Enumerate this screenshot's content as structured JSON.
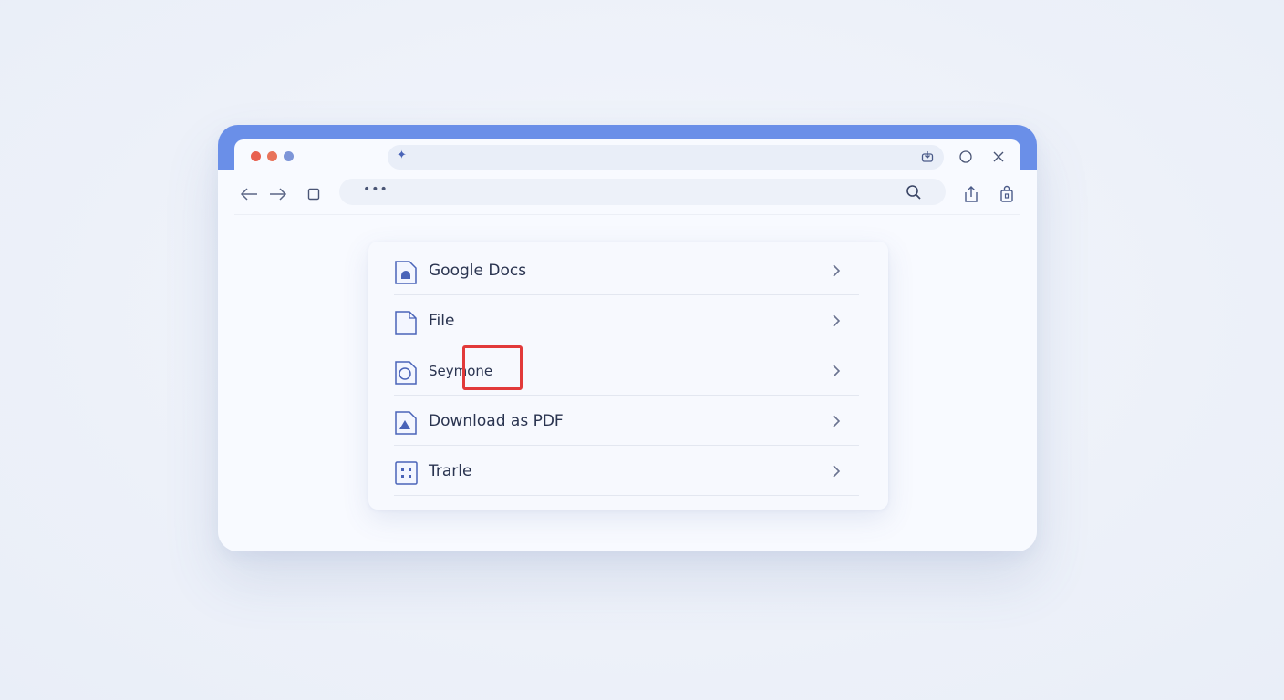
{
  "browser": {
    "url_placeholder": "•••",
    "top_icon": "sparkle-icon"
  },
  "menu": {
    "items": [
      {
        "label": "Google Docs",
        "icon": "google-docs-icon"
      },
      {
        "label": "File",
        "icon": "file-icon"
      },
      {
        "label": "Seymone",
        "icon": "circle-doc-icon"
      },
      {
        "label": "Download as PDF",
        "icon": "pdf-icon"
      },
      {
        "label": "Trarle",
        "icon": "grid-doc-icon"
      }
    ]
  },
  "colors": {
    "accent": "#6a8fe8",
    "icon": "#4a64b8",
    "highlight": "#e23a3a",
    "traffic_red": "#e8604f",
    "traffic_orange": "#e8735a",
    "traffic_blue": "#7d95d8"
  }
}
